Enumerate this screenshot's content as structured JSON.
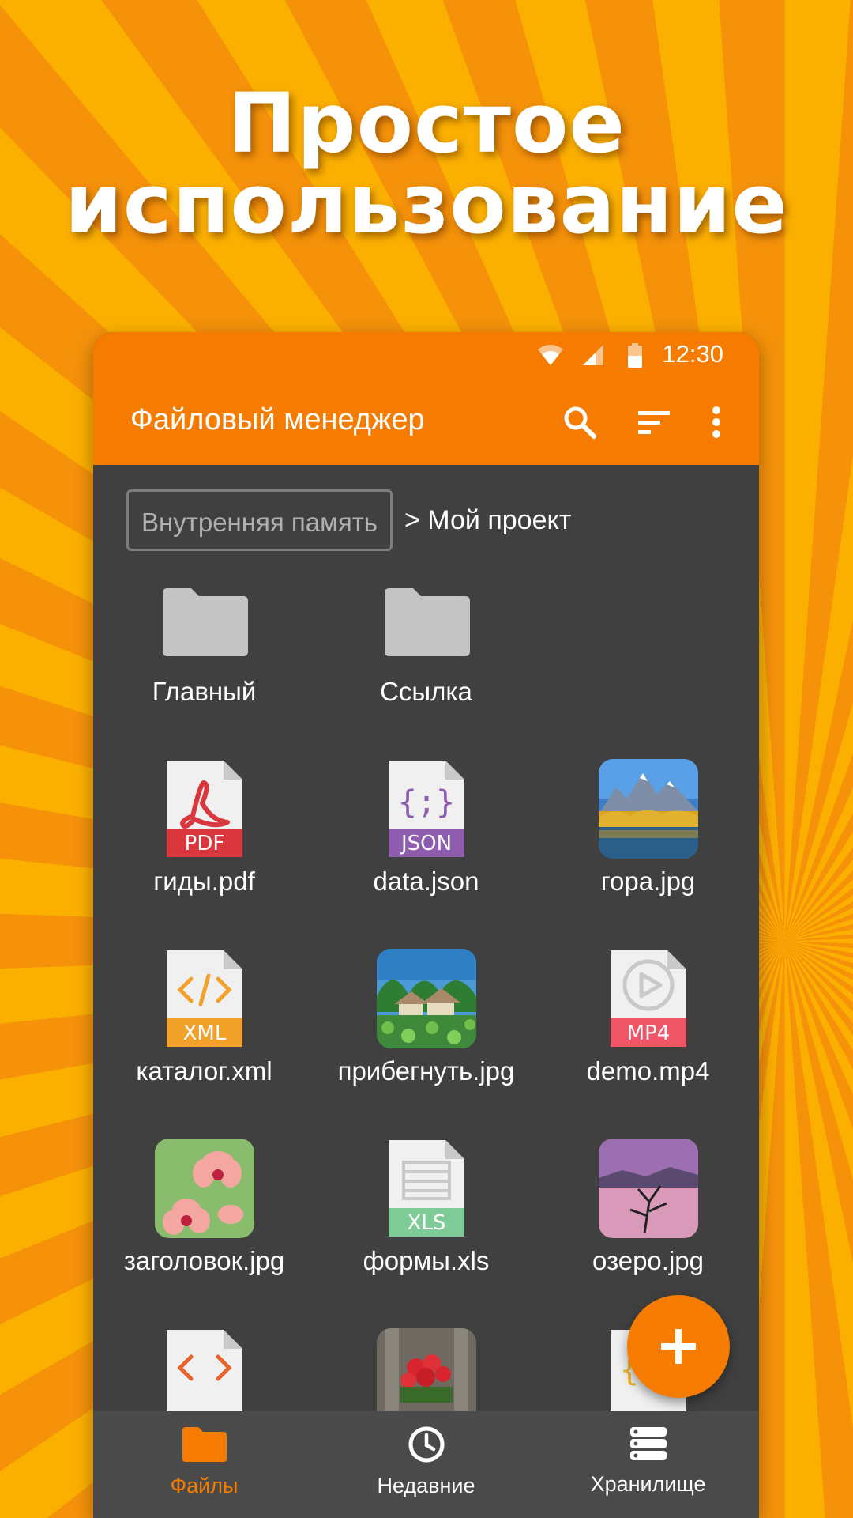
{
  "headline": {
    "line1": "Простое",
    "line2": "использование"
  },
  "status_bar": {
    "time": "12:30",
    "icons": [
      "wifi-icon",
      "signal-icon",
      "battery-icon"
    ]
  },
  "app_bar": {
    "title": "Файловый менеджер",
    "actions": [
      "search-icon",
      "sort-icon",
      "more-vert-icon"
    ]
  },
  "breadcrumb": {
    "root": "Внутренняя память",
    "current": "> Мой проект"
  },
  "files": [
    {
      "name": "Главный",
      "icon": "folder-icon"
    },
    {
      "name": "Ссылка",
      "icon": "folder-icon"
    },
    {
      "name": "гиды.pdf",
      "icon": "pdf-icon",
      "badge": "PDF"
    },
    {
      "name": "data.json",
      "icon": "json-icon",
      "badge": "JSON"
    },
    {
      "name": "гора.jpg",
      "icon": "mountain-image-thumbnail"
    },
    {
      "name": "каталог.xml",
      "icon": "xml-icon",
      "badge": "XML"
    },
    {
      "name": "прибегнуть.jpg",
      "icon": "resort-image-thumbnail"
    },
    {
      "name": "demo.mp4",
      "icon": "mp4-icon",
      "badge": "MP4"
    },
    {
      "name": "заголовок.jpg",
      "icon": "orchid-image-thumbnail"
    },
    {
      "name": "формы.xls",
      "icon": "xls-icon",
      "badge": "XLS"
    },
    {
      "name": "озеро.jpg",
      "icon": "lake-image-thumbnail"
    }
  ],
  "bottom_nav": [
    {
      "label": "Файлы",
      "icon": "folder-icon",
      "active": true
    },
    {
      "label": "Недавние",
      "icon": "clock-icon",
      "active": false
    },
    {
      "label": "Хранилище",
      "icon": "storage-icon",
      "active": false
    }
  ],
  "fab": {
    "icon": "plus-icon"
  },
  "colors": {
    "accent": "#f57c00",
    "pdf": "#d9363e",
    "json": "#8e5db0",
    "xml": "#f2a22a",
    "mp4": "#f05566",
    "xls": "#7fcb98",
    "background": "#404040"
  }
}
